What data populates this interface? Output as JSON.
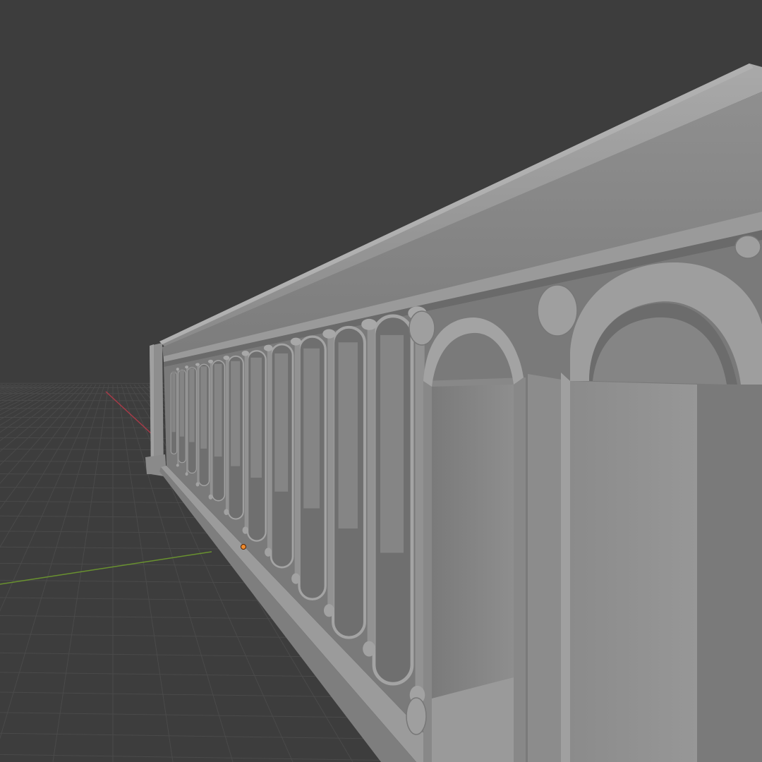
{
  "viewport": {
    "background": "#3d3d3d",
    "grid_color": "#4a4a4a",
    "x_axis_color": "#c4394a",
    "y_axis_color": "#6e9b2e",
    "origin_marker_color": "#f08c2e"
  },
  "model": {
    "type": "balustrade",
    "base_color": "#8c8c8c",
    "light_color": "#a2a2a2",
    "dark_color": "#6e6e6e",
    "shadow_color": "#5c5c5c",
    "arch_count": 16
  }
}
